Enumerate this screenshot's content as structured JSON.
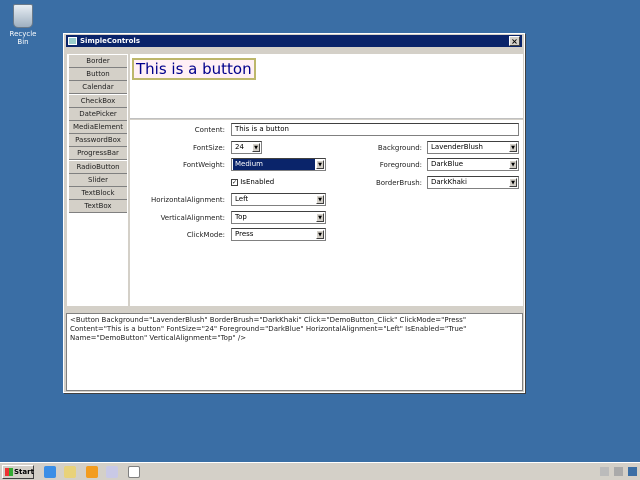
{
  "desktop": {
    "recycle_bin": "Recycle Bin"
  },
  "window": {
    "title": "SimpleControls",
    "close": "×"
  },
  "nav": [
    "Border",
    "Button",
    "Calendar",
    "CheckBox",
    "DatePicker",
    "MediaElement",
    "PasswordBox",
    "ProgressBar",
    "RadioButton",
    "Slider",
    "TextBlock",
    "TextBox"
  ],
  "demo": {
    "content": "This is a button",
    "background": "#fff0f5",
    "foreground": "#00008b",
    "border": "#bdb76b"
  },
  "form": {
    "content_label": "Content:",
    "content_value": "This is a button",
    "fontsize_label": "FontSize:",
    "fontsize_value": "24",
    "fontweight_label": "FontWeight:",
    "fontweight_value": "Medium",
    "isenabled_label": "IsEnabled",
    "halign_label": "HorizontalAlignment:",
    "halign_value": "Left",
    "valign_label": "VerticalAlignment:",
    "valign_value": "Top",
    "clickmode_label": "ClickMode:",
    "clickmode_value": "Press",
    "background_label": "Background:",
    "background_value": "LavenderBlush",
    "foreground_label": "Foreground:",
    "foreground_value": "DarkBlue",
    "borderbrush_label": "BorderBrush:",
    "borderbrush_value": "DarkKhaki"
  },
  "xaml": "<Button Background=\"LavenderBlush\" BorderBrush=\"DarkKhaki\" Click=\"DemoButton_Click\" ClickMode=\"Press\" Content=\"This is a button\" FontSize=\"24\" Foreground=\"DarkBlue\" HorizontalAlignment=\"Left\" IsEnabled=\"True\" Name=\"DemoButton\" VerticalAlignment=\"Top\" />",
  "taskbar": {
    "start": "Start"
  }
}
